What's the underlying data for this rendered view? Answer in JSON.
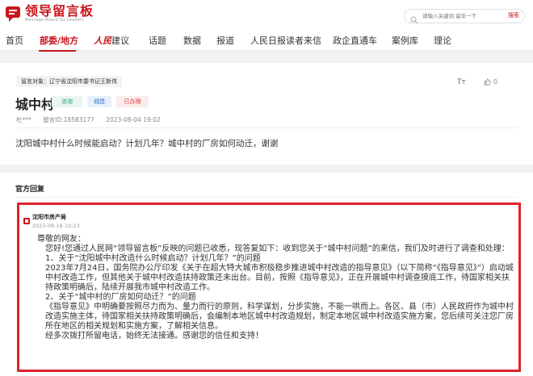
{
  "header": {
    "logo_title": "领导留言板",
    "logo_sub": "Message Board for Leaders",
    "search_placeholder": "请输入关键词 留年一下",
    "search_button": "搜索"
  },
  "nav": {
    "items": [
      "首页",
      "部委/地方",
      "建议",
      "话题",
      "数据",
      "报道",
      "人民日报读者来信",
      "政企直通车",
      "案例库",
      "理论"
    ],
    "rm_logo": "人民"
  },
  "message": {
    "target": "留言对象：辽宁省沈阳市委书记王新伟",
    "title": "城中村",
    "tags": [
      "咨询",
      "城建",
      "已办理"
    ],
    "author": "杜***",
    "message_id": "留言ID:18583177",
    "datetime": "2023-08-04 19:02",
    "font_toggle": "Tт",
    "likes": "0",
    "question": "沈阳城中村什么时候能启动？计划几年？城中村的厂房如何动迁，谢谢"
  },
  "reply": {
    "heading": "官方回复",
    "org": "沈阳市房产局",
    "date": "2023-08-18 10:23",
    "paragraphs": [
      "尊敬的网友：",
      "您好!您通过人民网“领导留言板”反映的问题已收悉，现答复如下：收到您关于“城中村问题”的来信，我们及时进行了调查和处理：",
      "1、关于“沈阳城中村改造什么时候启动？计划几年？”的问题",
      "2023年7月24日，国务院办公厅印发《关于在超大特大城市积极稳步推进城中村改造的指导意见》（以下简称“《指导意见》”）启动城中村改造工作，但其他关于城中村改造扶持政策还未出台。目前，按照《指导意见》，正在开展城中村调查摸底工作，待国家相关扶持政策明确后，陆续开展我市城中村改造工作。",
      "2、关于“城中村的厂房如何动迁？”的问题",
      "《指导意见》中明确要按照尽力而为、量力而行的原则，科学谋划，分步实施，不能一哄而上。各区、县（市）人民政府作为城中村改造实施主体，待国家相关扶持政策明确后，会编制本地区城中村改造规划，制定本地区城中村改造实施方案，您后续可关注您厂房所在地区的相关规划和实施方案，了解相关信息。",
      "经多次拨打所留电话，始终无法接通。感谢您的信任和支持！"
    ]
  },
  "colors": {
    "brand": "#c8161d",
    "highlight_border": "#e0212a"
  }
}
